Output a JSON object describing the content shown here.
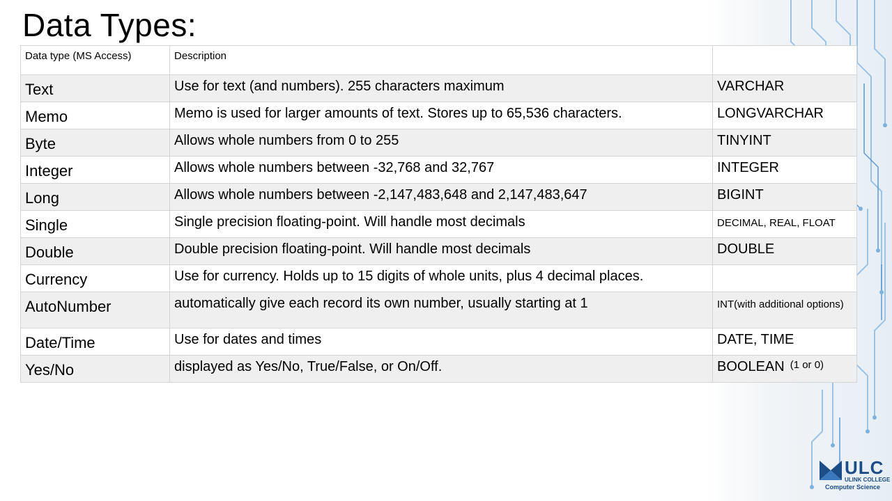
{
  "slide": {
    "title": "Data Types:"
  },
  "table": {
    "headers": [
      "Data type (MS Access)",
      "Description",
      ""
    ],
    "rows": [
      {
        "type": "Text",
        "description": "Use for text (and numbers). 255 characters maximum",
        "sql": "VARCHAR",
        "sql_note": ""
      },
      {
        "type": "Memo",
        "description": "Memo is used for larger amounts of text. Stores up to 65,536 characters.",
        "sql": "LONGVARCHAR",
        "sql_note": ""
      },
      {
        "type": "Byte",
        "description": "Allows whole numbers from 0 to 255",
        "sql": "TINYINT",
        "sql_note": ""
      },
      {
        "type": "Integer",
        "description": "Allows whole numbers between -32,768 and 32,767",
        "sql": "INTEGER",
        "sql_note": ""
      },
      {
        "type": "Long",
        "description": "Allows whole numbers between -2,147,483,648 and 2,147,483,647",
        "sql": "BIGINT",
        "sql_note": ""
      },
      {
        "type": "Single",
        "description": "Single precision floating-point. Will handle most decimals",
        "sql": "DECIMAL, REAL, FLOAT",
        "sql_note": ""
      },
      {
        "type": "Double",
        "description": "Double precision floating-point. Will handle most decimals",
        "sql": "DOUBLE",
        "sql_note": ""
      },
      {
        "type": "Currency",
        "description": "Use for currency. Holds up to 15 digits of whole units, plus 4 decimal places.",
        "sql": "",
        "sql_note": ""
      },
      {
        "type": "AutoNumber",
        "description": "automatically give each record its own number, usually starting at 1",
        "sql": "INT(with additional options)",
        "sql_note": ""
      },
      {
        "type": "Date/Time",
        "description": "Use for dates and times",
        "sql": "DATE, TIME",
        "sql_note": ""
      },
      {
        "type": "Yes/No",
        "description": "displayed as Yes/No, True/False, or On/Off.",
        "sql": "BOOLEAN",
        "sql_note": "(1 or 0)"
      }
    ]
  },
  "logo": {
    "name": "ULC",
    "subtitle": "ULINK COLLEGE",
    "department": "Computer Science"
  },
  "colors": {
    "row_alt": "#efefef",
    "border": "#d4d4d4",
    "logo_blue": "#1d4d86",
    "circuit_blue": "#5b9bd5"
  }
}
